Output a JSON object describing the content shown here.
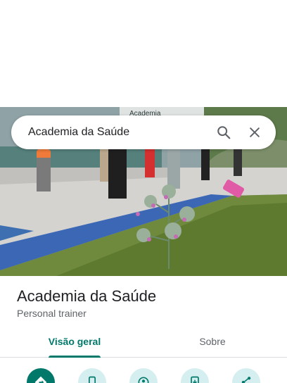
{
  "search": {
    "query": "Academia da Saúde",
    "search_icon": "search-icon",
    "close_icon": "close-icon"
  },
  "photo": {
    "sign_text": "Academia"
  },
  "place": {
    "name": "Academia da Saúde",
    "category": "Personal trainer"
  },
  "tabs": [
    {
      "label": "Visão geral",
      "active": true
    },
    {
      "label": "Sobre",
      "active": false
    }
  ],
  "actions": [
    {
      "icon": "directions-icon"
    },
    {
      "icon": "phone-icon"
    },
    {
      "icon": "nearby-icon"
    },
    {
      "icon": "save-to-phone-icon"
    },
    {
      "icon": "share-icon"
    }
  ],
  "colors": {
    "accent": "#00796b",
    "action_bg": "#d5eff1",
    "text_primary": "#202124",
    "text_secondary": "#5f6368"
  }
}
